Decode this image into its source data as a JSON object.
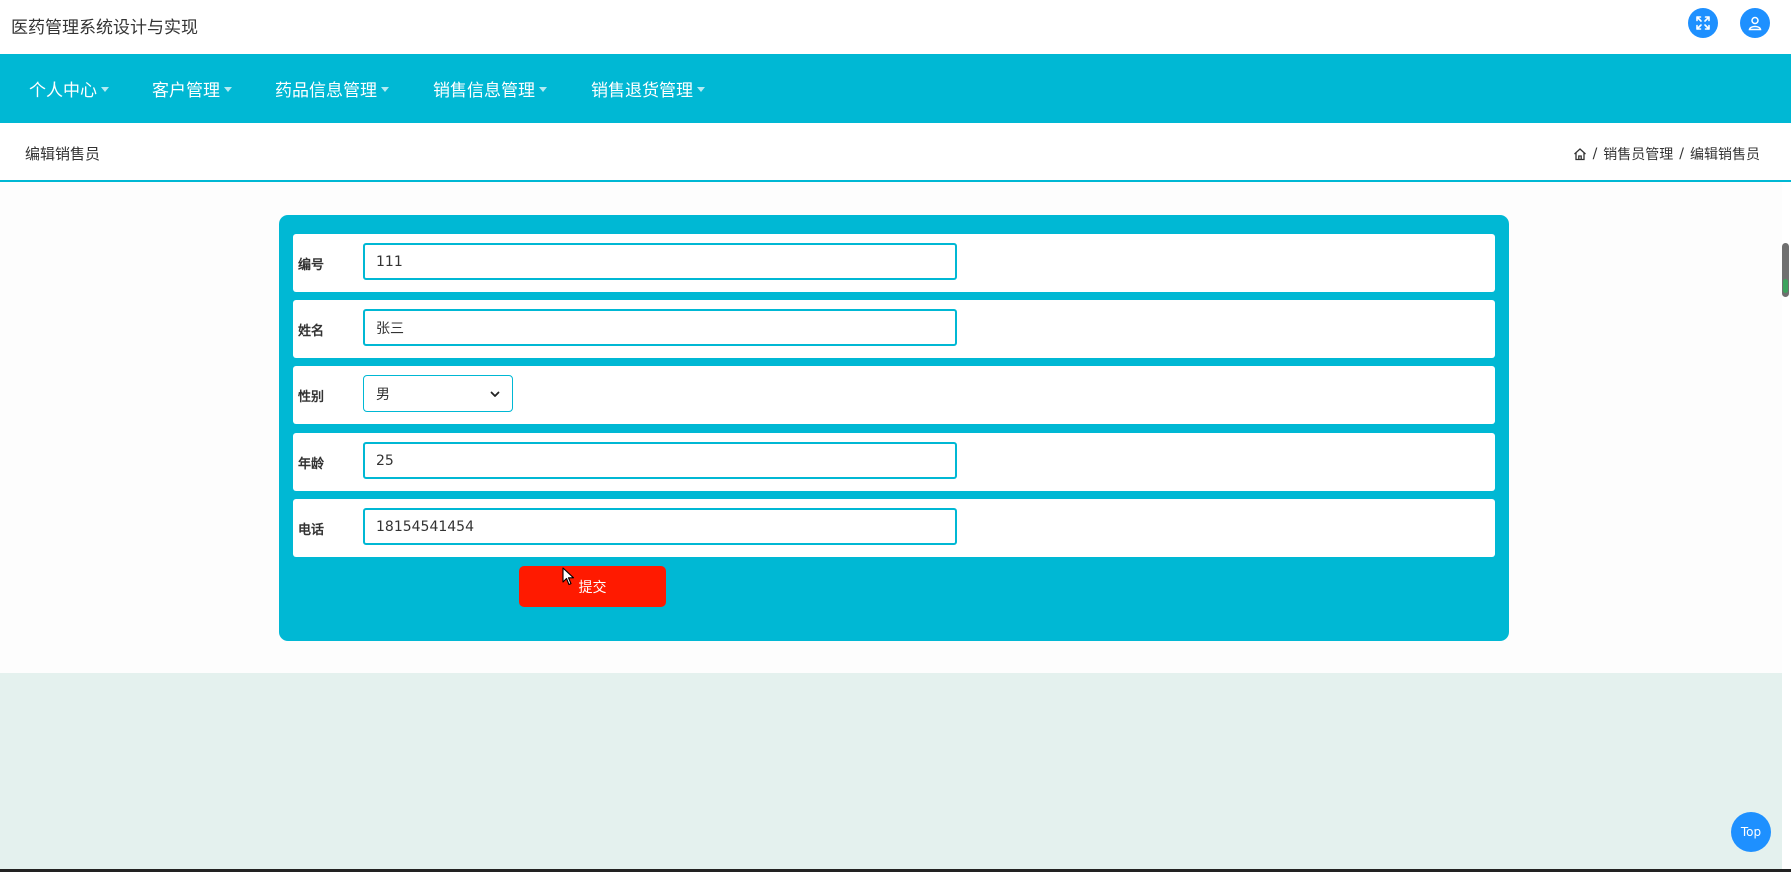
{
  "app": {
    "title": "医药管理系统设计与实现"
  },
  "header_icons": {
    "fullscreen": "fullscreen-icon",
    "user": "user-icon"
  },
  "nav": {
    "items": [
      {
        "label": "个人中心"
      },
      {
        "label": "客户管理"
      },
      {
        "label": "药品信息管理"
      },
      {
        "label": "销售信息管理"
      },
      {
        "label": "销售退货管理"
      }
    ]
  },
  "page_header": {
    "title": "编辑销售员",
    "breadcrumb": [
      "销售员管理",
      "编辑销售员"
    ]
  },
  "form": {
    "fields": [
      {
        "label": "编号",
        "value": "111"
      },
      {
        "label": "姓名",
        "value": "张三"
      },
      {
        "label": "性别",
        "value": "男"
      },
      {
        "label": "年龄",
        "value": "25"
      },
      {
        "label": "电话",
        "value": "18154541454"
      }
    ],
    "submit_label": "提交"
  },
  "top_button": {
    "label": "Top"
  },
  "colors": {
    "accent": "#00b8d4",
    "submit": "#ff1a00",
    "icon_button": "#1e90ff",
    "lower_background": "#e4f1ee"
  }
}
